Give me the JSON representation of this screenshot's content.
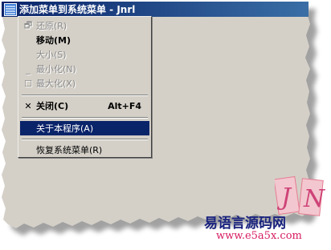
{
  "window": {
    "title": "添加菜单到系统菜单 - Jnrl",
    "icon": "app-stripes-icon"
  },
  "menu": {
    "items": [
      {
        "label": "还原(R)",
        "icon": "restore-icon",
        "glyph": "🗗",
        "state": "disabled"
      },
      {
        "label": "移动(M)",
        "icon": "",
        "glyph": "",
        "state": "normal"
      },
      {
        "label": "大小(S)",
        "icon": "",
        "glyph": "",
        "state": "disabled"
      },
      {
        "label": "最小化(N)",
        "icon": "minimize-icon",
        "glyph": "_",
        "state": "disabled"
      },
      {
        "label": "最大化(X)",
        "icon": "maximize-icon",
        "glyph": "☐",
        "state": "disabled"
      },
      {
        "label": "关闭(C)",
        "icon": "close-icon",
        "glyph": "✕",
        "state": "bold",
        "accelerator": "Alt+F4"
      },
      {
        "label": "关于本程序(A)",
        "icon": "",
        "glyph": "",
        "state": "selected"
      },
      {
        "label": "恢复系统菜单(R)",
        "icon": "",
        "glyph": "",
        "state": "normal"
      }
    ]
  },
  "watermark": {
    "text": "易语言源码网",
    "url": "www.e5a5x.com",
    "logo_letters": "JN"
  },
  "colors": {
    "titlebar_start": "#0a246a",
    "titlebar_end": "#3a6ea5",
    "menu_face": "#d4d0c8",
    "selection": "#0a246a",
    "watermark_text": "#1a237e",
    "watermark_url": "#d81b60"
  }
}
